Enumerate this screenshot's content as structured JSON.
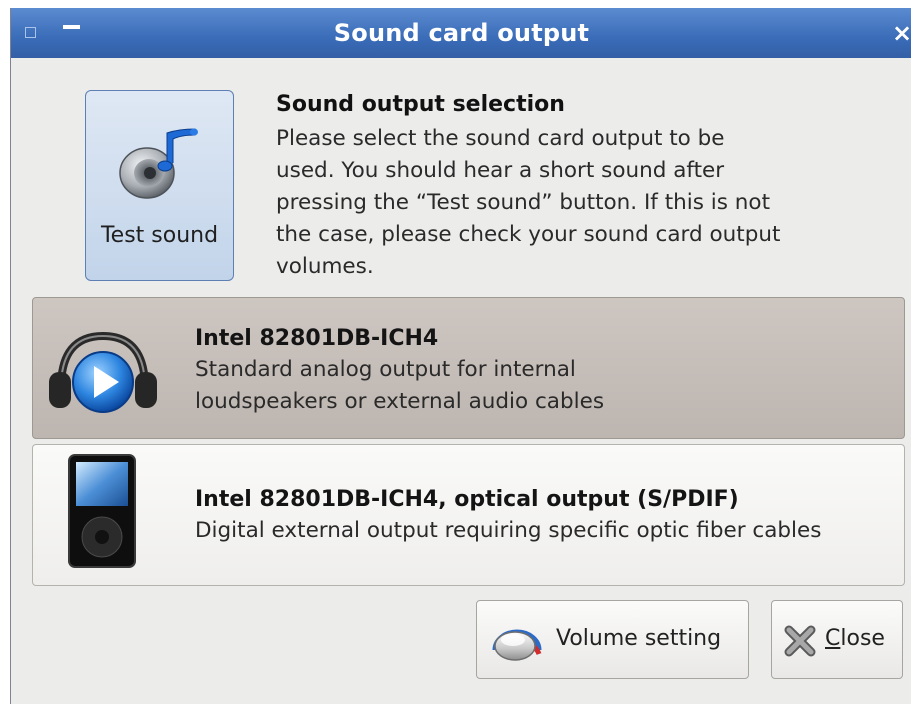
{
  "window": {
    "title": "Sound card output",
    "close_glyph": "×"
  },
  "test_button": {
    "label": "Test sound",
    "icon": "speaker-music-note-icon"
  },
  "info": {
    "title": "Sound output selection",
    "lines": [
      "Please select the sound card output to be",
      "used. You should hear a short sound after",
      "pressing the “Test sound” button. If this is not",
      "the case, please check your sound card output",
      "volumes."
    ]
  },
  "outputs": [
    {
      "name": "Intel 82801DB-ICH4",
      "description_lines": [
        "Standard analog output for internal",
        "loudspeakers or external audio cables"
      ],
      "icon": "headphones-play-icon",
      "selected": true
    },
    {
      "name": "Intel 82801DB-ICH4, optical output (S/PDIF)",
      "description_lines": [
        "Digital external output requiring specific optic fiber cables"
      ],
      "icon": "media-player-icon",
      "selected": false
    }
  ],
  "buttons": {
    "volume": {
      "label": "Volume setting",
      "icon": "volume-knob-icon"
    },
    "close": {
      "label_mnemonic": "C",
      "label_rest": "lose",
      "icon": "close-x-icon"
    }
  },
  "colors": {
    "titlebar": "#3a6cb8",
    "window_bg": "#ececeb",
    "selected_row": "#c5beb9"
  }
}
